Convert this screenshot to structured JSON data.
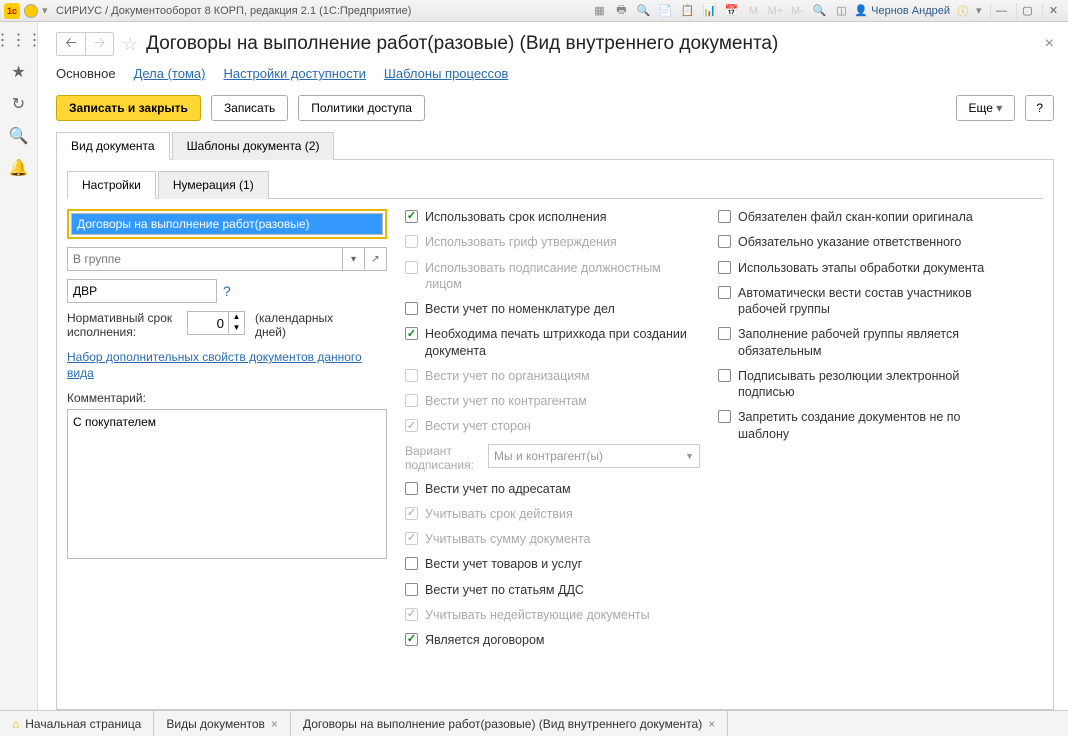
{
  "titlebar": {
    "title": "СИРИУС / Документооборот 8 КОРП, редакция 2.1  (1С:Предприятие)",
    "user": "Чернов Андрей",
    "mlabels": [
      "М",
      "М+",
      "М-"
    ]
  },
  "page": {
    "title": "Договоры на выполнение работ(разовые) (Вид внутреннего документа)"
  },
  "nav": {
    "main": "Основное",
    "dela": "Дела (тома)",
    "access": "Настройки доступности",
    "templates": "Шаблоны процессов"
  },
  "toolbar": {
    "save_close": "Записать и закрыть",
    "save": "Записать",
    "policies": "Политики доступа",
    "more": "Еще",
    "help": "?"
  },
  "tabs": {
    "doctype": "Вид документа",
    "doc_templates": "Шаблоны документа (2)",
    "settings": "Настройки",
    "numbering": "Нумерация (1)"
  },
  "form": {
    "name": "Договоры на выполнение работ(разовые)",
    "group_placeholder": "В группе",
    "code": "ДВР",
    "norm_label": "Нормативный срок исполнения:",
    "norm_value": "0",
    "norm_unit": "(календарных дней)",
    "propset_link": "Набор дополнительных свойств документов данного вида",
    "comment_label": "Комментарий:",
    "comment": "С покупателем"
  },
  "checks2": {
    "c1": {
      "label": "Использовать срок исполнения",
      "checked": true,
      "disabled": false
    },
    "c2": {
      "label": "Использовать гриф утверждения",
      "checked": false,
      "disabled": true
    },
    "c3": {
      "label": "Использовать подписание должностным лицом",
      "checked": false,
      "disabled": true
    },
    "c4": {
      "label": "Вести учет по номенклатуре дел",
      "checked": false,
      "disabled": false
    },
    "c5": {
      "label": "Необходима печать штрихкода при создании документа",
      "checked": true,
      "disabled": false
    },
    "c6": {
      "label": "Вести учет по организациям",
      "checked": false,
      "disabled": true
    },
    "c7": {
      "label": "Вести учет по контрагентам",
      "checked": false,
      "disabled": true
    },
    "c8": {
      "label": "Вести учет сторон",
      "checked": true,
      "disabled": true
    },
    "variant_label": "Вариант подписания:",
    "variant_value": "Мы и контрагент(ы)",
    "c9": {
      "label": "Вести учет по адресатам",
      "checked": false,
      "disabled": false
    },
    "c10": {
      "label": "Учитывать срок действия",
      "checked": true,
      "disabled": true
    },
    "c11": {
      "label": "Учитывать сумму документа",
      "checked": true,
      "disabled": true
    },
    "c12": {
      "label": "Вести учет товаров и услуг",
      "checked": false,
      "disabled": false
    },
    "c13": {
      "label": "Вести учет по статьям ДДС",
      "checked": false,
      "disabled": false
    },
    "c14": {
      "label": "Учитывать недействующие документы",
      "checked": true,
      "disabled": true
    },
    "c15": {
      "label": "Является договором",
      "checked": true,
      "disabled": false
    }
  },
  "checks3": {
    "d1": {
      "label": "Обязателен файл скан-копии оригинала",
      "checked": false
    },
    "d2": {
      "label": "Обязательно указание ответственного",
      "checked": false
    },
    "d3": {
      "label": "Использовать этапы обработки документа",
      "checked": false
    },
    "d4": {
      "label": "Автоматически вести состав участников рабочей группы",
      "checked": false
    },
    "d5": {
      "label": "Заполнение рабочей группы является обязательным",
      "checked": false
    },
    "d6": {
      "label": "Подписывать резолюции электронной подписью",
      "checked": false
    },
    "d7": {
      "label": "Запретить создание документов не по шаблону",
      "checked": false
    }
  },
  "bottom": {
    "home": "Начальная страница",
    "doctypes": "Виды документов",
    "current": "Договоры на выполнение работ(разовые) (Вид внутреннего документа)"
  }
}
